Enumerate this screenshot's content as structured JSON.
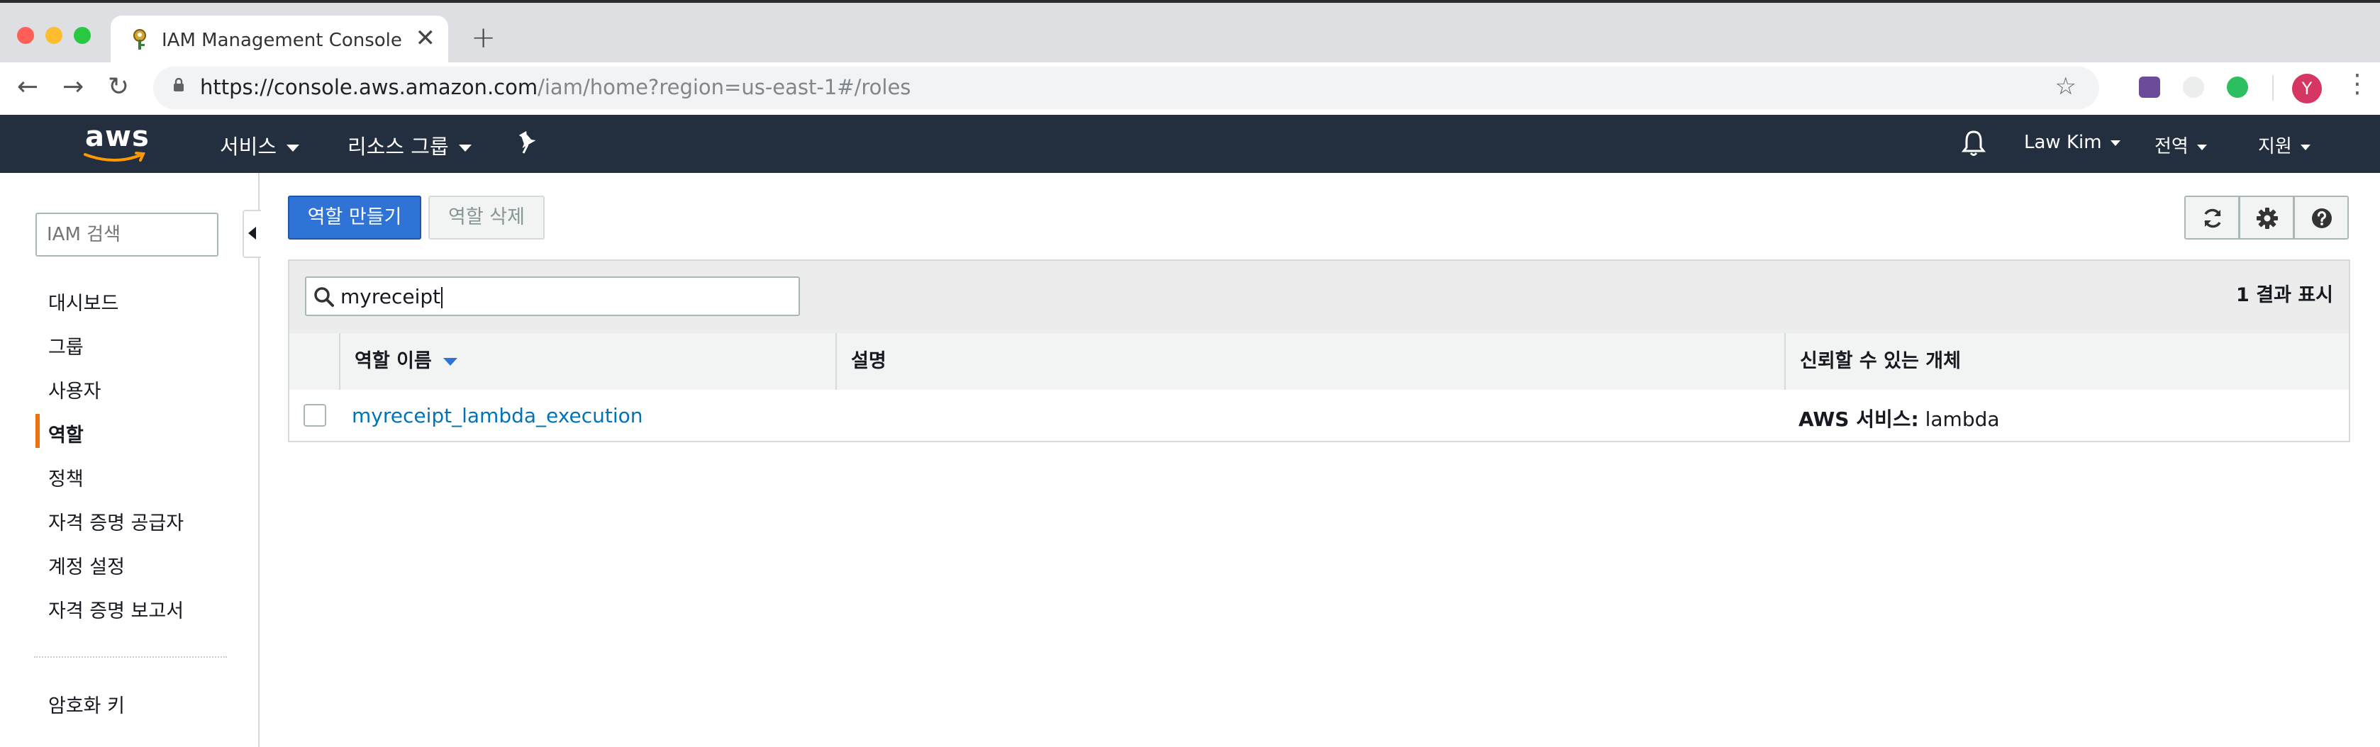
{
  "browser": {
    "tab_title": "IAM Management Console",
    "tab_close": "✕",
    "new_tab": "+",
    "url_host": "https://console.aws.amazon.com",
    "url_path": "/iam/home?region=us-east-1#/roles",
    "avatar_letter": "Y",
    "back_icon": "←",
    "forward_icon": "→",
    "reload_icon": "↻",
    "star_icon": "☆",
    "menu_icon": "⋮",
    "colors": {
      "close": "#ff5f57",
      "minimize": "#febc2e",
      "maximize": "#28c840"
    }
  },
  "aws_nav": {
    "logo_text": "aws",
    "services": "서비스",
    "resource_groups": "리소스 그룹",
    "user": "Law Kim",
    "region": "전역",
    "support": "지원",
    "colors": {
      "background": "#232f3e",
      "logo_smile": "#ff9900"
    }
  },
  "sidebar": {
    "search_placeholder": "IAM 검색",
    "items": [
      {
        "label": "대시보드"
      },
      {
        "label": "그룹"
      },
      {
        "label": "사용자"
      },
      {
        "label": "역할",
        "active": true
      },
      {
        "label": "정책"
      },
      {
        "label": "자격 증명 공급자"
      },
      {
        "label": "계정 설정"
      },
      {
        "label": "자격 증명 보고서"
      }
    ],
    "bottom_items": [
      {
        "label": "암호화 키"
      }
    ],
    "colors": {
      "active_accent": "#ec7211"
    }
  },
  "toolbar": {
    "create_role": "역할 만들기",
    "delete_role": "역할 삭제",
    "colors": {
      "primary": "#2f73d6"
    }
  },
  "filter": {
    "search_value": "myreceipt",
    "results": "1 결과 표시"
  },
  "table": {
    "columns": [
      "역할 이름",
      "설명",
      "신뢰할 수 있는 개체"
    ],
    "rows": [
      {
        "name": "myreceipt_lambda_execution",
        "description": "",
        "trusted_label": "AWS 서비스:",
        "trusted_value": "lambda"
      }
    ],
    "colors": {
      "link": "#0073bb"
    }
  }
}
